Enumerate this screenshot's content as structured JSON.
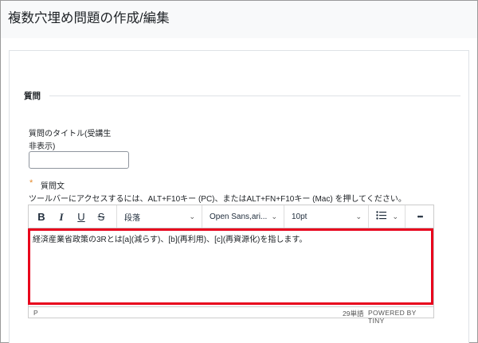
{
  "page": {
    "title": "複数穴埋め問題の作成/編集"
  },
  "form": {
    "section_legend": "質問",
    "title_field": {
      "label_line1": "質問のタイトル(受講生",
      "label_line2": "非表示)",
      "value": ""
    },
    "question_text": {
      "required_marker": "*",
      "label": "質問文",
      "help": "ツールバーにアクセスするには、ALT+F10キー (PC)、またはALT+FN+F10キー (Mac) を押してください。"
    }
  },
  "editor": {
    "toolbar": {
      "bold": "B",
      "italic": "I",
      "underline": "U",
      "strikethrough": "S",
      "block_format": "段落",
      "font_family": "Open Sans,ari...",
      "font_size": "10pt",
      "more": "•••"
    },
    "content": "経済産業省政策の3Rとは[a](減らす)、[b](再利用)、[c](再資源化)を指します。",
    "status": {
      "path": "P",
      "word_count": "29単語",
      "branding": "POWERED BY TINY"
    }
  },
  "colors": {
    "highlight_border": "#e8001c",
    "required_marker": "#e4892b",
    "header_bg": "#f8f9fa"
  },
  "icons": {
    "list": "bullet-list-icon",
    "dropdown": "chevron-down-icon",
    "more": "more-horizontal-icon"
  }
}
